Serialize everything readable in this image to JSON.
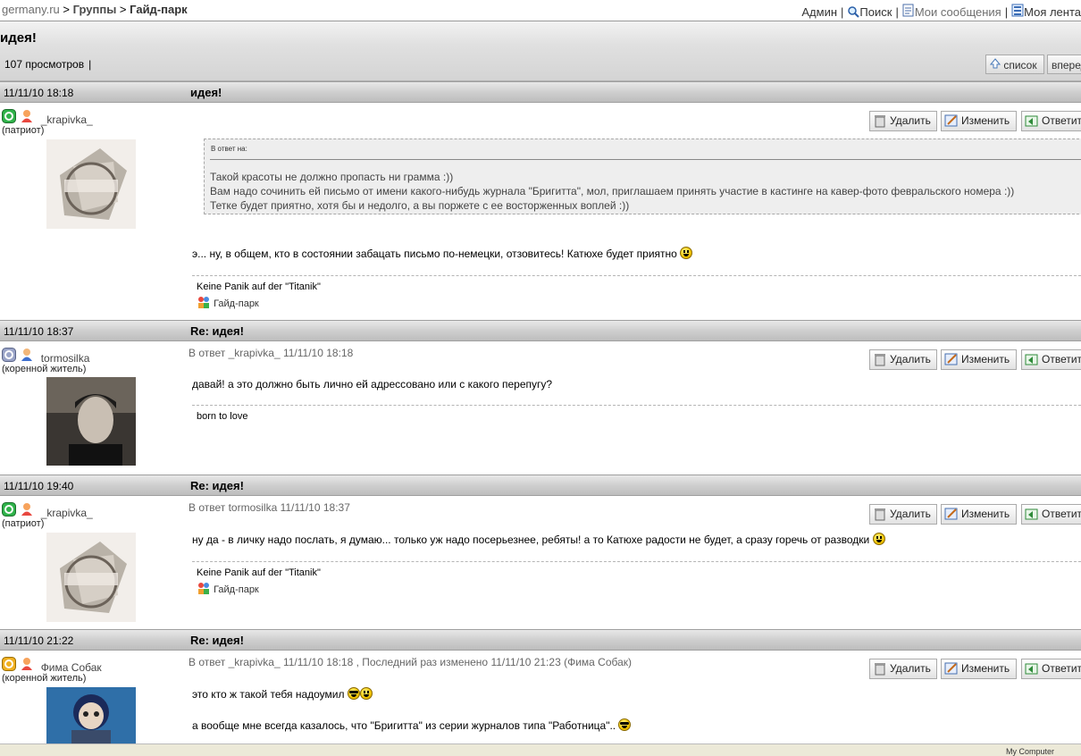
{
  "breadcrumb": {
    "site": "germany.ru",
    "sep1": " > ",
    "groups": "Группы",
    "sep2": " > ",
    "current": "Гайд-парк"
  },
  "top_nav": {
    "admin": "Админ",
    "search": "Поиск",
    "messages": "Мои сообщения",
    "feed": "Моя лента",
    "separator": "|"
  },
  "thread": {
    "title": "идея!",
    "views": "107 просмотров",
    "pipe": "|",
    "list_button": "список",
    "next_button": "вперед"
  },
  "buttons": {
    "delete": "Удалить",
    "edit": "Изменить",
    "reply": "Ответить"
  },
  "posts": [
    {
      "date": "11/11/10 18:18",
      "subject": "идея!",
      "user": "_krapivka_",
      "rank": "(патриот)",
      "quote": {
        "label": "В ответ на:",
        "lines": [
          "Такой красоты не должно пропасть ни грамма :))",
          "Вам надо сочинить ей письмо от имени какого-нибудь журнала \"Бригитта\", мол, приглашаем принять участие в кастинге на кавер-фото февральского номера :))",
          "Тетке будет приятно, хотя бы и недолго, а вы поржете с ее восторженных воплей :))"
        ]
      },
      "body": "э... ну, в общем, кто в состоянии забацать письмо по-немецки, отзовитесь! Катюхе будет приятно",
      "signature": "Keine Panik auf der \"Titanik\"",
      "signature_link": "Гайд-парк"
    },
    {
      "date": "11/11/10 18:37",
      "subject": "Re: идея!",
      "user": "tormosilka",
      "rank": "(коренной житель)",
      "reply_info": "В ответ _krapivka_ 11/11/10 18:18",
      "body": "давай! а это должно быть лично ей адрессовано или с какого перепугу?",
      "signature": "born to love"
    },
    {
      "date": "11/11/10 19:40",
      "subject": "Re: идея!",
      "user": "_krapivka_",
      "rank": "(патриот)",
      "reply_info": "В ответ tormosilka 11/11/10 18:37",
      "body": "ну да - в личку надо послать, я думаю... только уж надо посерьезнее, ребяты! а то Катюхе радости не будет, а сразу горечь от разводки",
      "signature": "Keine Panik auf der \"Titanik\"",
      "signature_link": "Гайд-парк"
    },
    {
      "date": "11/11/10 21:22",
      "subject": "Re: идея!",
      "user": "Фима Собак",
      "rank": "(коренной житель)",
      "reply_info": "В ответ _krapivka_ 11/11/10 18:18 , Последний раз изменено 11/11/10 21:23 (Фима Собак)",
      "body": "это кто ж такой тебя надоумил",
      "body2": "а вообще мне всегда казалось, что \"Бригитта\" из серии журналов типа \"Работница\".."
    }
  ],
  "taskbar": {
    "label": "My Computer"
  },
  "colors": {
    "post_header_bg": "#cfcfcf",
    "quote_bg": "#eeeeee",
    "link_gray": "#6e6e6e"
  }
}
